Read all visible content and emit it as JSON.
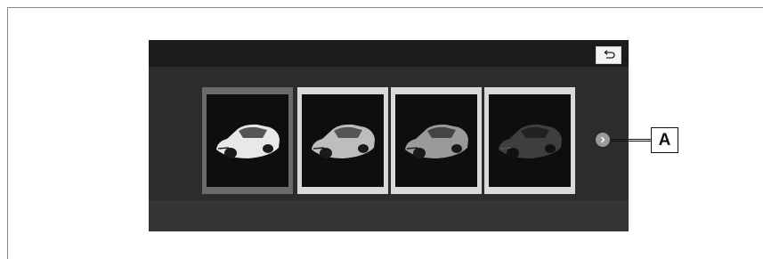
{
  "screen": {
    "back_icon": "return-arrow-icon",
    "next_icon": "chevron-right-icon",
    "vehicles": [
      {
        "name": "car-white",
        "body_color": "#e8e8e8",
        "selected": true
      },
      {
        "name": "car-silver",
        "body_color": "#bdbdbd",
        "selected": false
      },
      {
        "name": "car-gray",
        "body_color": "#9a9a9a",
        "selected": false
      },
      {
        "name": "car-dark",
        "body_color": "#3e3e3e",
        "selected": false
      }
    ]
  },
  "callout": {
    "label": "A"
  },
  "colors": {
    "screen_bg": "#2c2c2c",
    "header_bg": "#1c1c1c",
    "tile_selected": "#6a6a6a",
    "tile_normal": "#d9d9d9"
  }
}
